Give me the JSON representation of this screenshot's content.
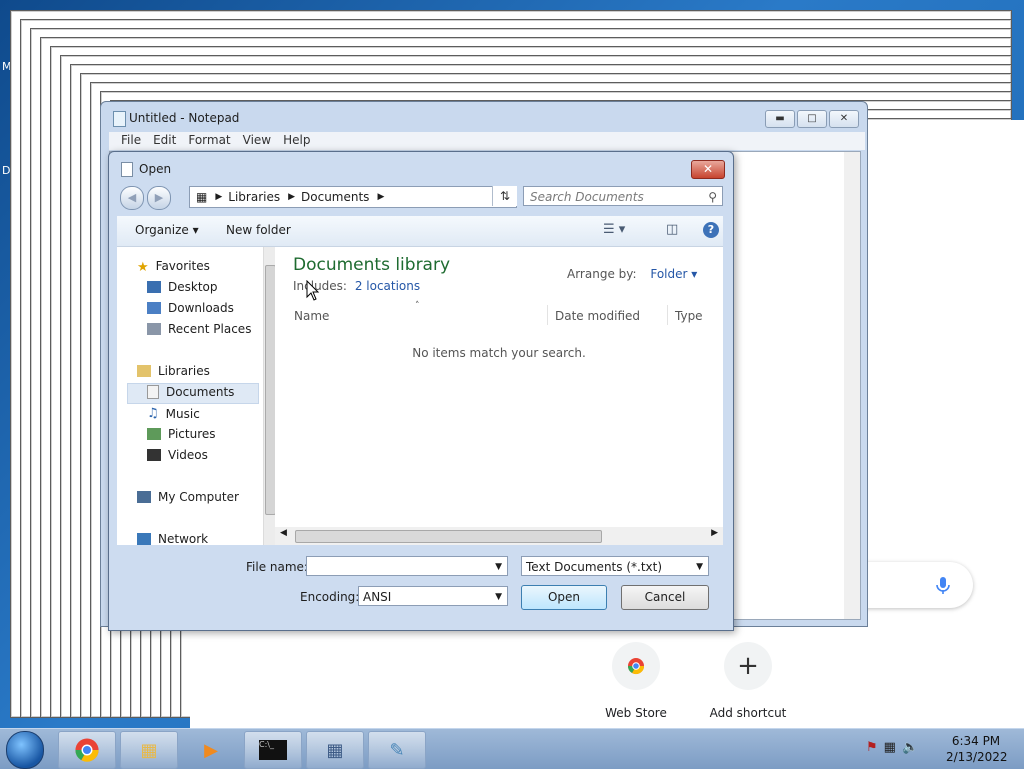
{
  "desktop": {
    "labels": [
      "M",
      "D"
    ]
  },
  "chrome": {
    "shortcuts": [
      {
        "label": "Web Store"
      },
      {
        "label": "Add shortcut",
        "glyph": "+"
      }
    ],
    "mic_color": "#4285f4"
  },
  "notepad": {
    "title": "Untitled - Notepad",
    "menu": [
      "File",
      "Edit",
      "Format",
      "View",
      "Help"
    ]
  },
  "dialog": {
    "title": "Open",
    "breadcrumb": [
      "Libraries",
      "Documents"
    ],
    "search_placeholder": "Search Documents",
    "toolbar": {
      "organize": "Organize",
      "new_folder": "New folder"
    },
    "nav": {
      "favorites": "Favorites",
      "favorites_items": [
        "Desktop",
        "Downloads",
        "Recent Places"
      ],
      "libraries": "Libraries",
      "libraries_items": [
        "Documents",
        "Music",
        "Pictures",
        "Videos"
      ],
      "selected": "Documents",
      "my_computer": "My Computer",
      "network": "Network"
    },
    "content": {
      "title": "Documents library",
      "includes_label": "Includes:",
      "includes_link": "2 locations",
      "arrange_label": "Arrange by:",
      "arrange_value": "Folder",
      "columns": [
        "Name",
        "Date modified",
        "Type"
      ],
      "empty": "No items match your search."
    },
    "filename_label": "File name:",
    "filename_value": "",
    "filetype": "Text Documents (*.txt)",
    "encoding_label": "Encoding:",
    "encoding_value": "ANSI",
    "open_label": "Open",
    "cancel_label": "Cancel"
  },
  "taskbar": {
    "time": "6:34 PM",
    "date": "2/13/2022"
  }
}
